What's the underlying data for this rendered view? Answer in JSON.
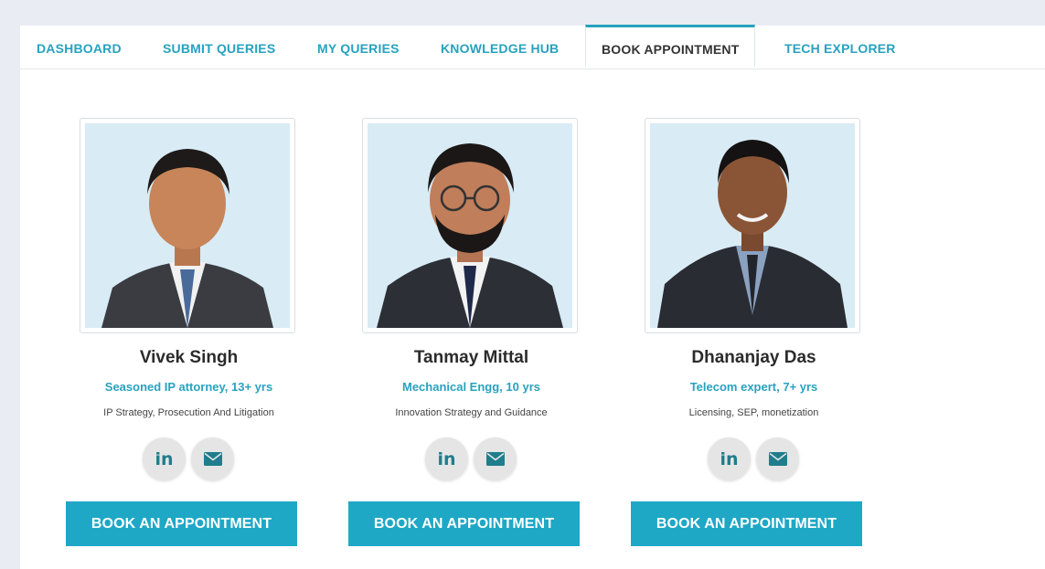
{
  "tabs": [
    {
      "label": "DASHBOARD",
      "active": false
    },
    {
      "label": "SUBMIT QUERIES",
      "active": false
    },
    {
      "label": "MY QUERIES",
      "active": false
    },
    {
      "label": "KNOWLEDGE HUB",
      "active": false
    },
    {
      "label": "BOOK APPOINTMENT",
      "active": true
    },
    {
      "label": "TECH EXPLORER",
      "active": false
    }
  ],
  "experts": [
    {
      "name": "Vivek Singh",
      "role": "Seasoned IP attorney, 13+ yrs",
      "specialty": "IP Strategy, Prosecution And Litigation",
      "linkedin_label": "in",
      "book_label": "BOOK AN APPOINTMENT"
    },
    {
      "name": "Tanmay Mittal",
      "role": "Mechanical Engg, 10 yrs",
      "specialty": "Innovation Strategy and Guidance",
      "linkedin_label": "in",
      "book_label": "BOOK AN APPOINTMENT"
    },
    {
      "name": "Dhananjay Das",
      "role": "Telecom expert, 7+ yrs",
      "specialty": "Licensing, SEP, monetization",
      "linkedin_label": "in",
      "book_label": "BOOK AN APPOINTMENT"
    }
  ],
  "colors": {
    "accent": "#27a2bf",
    "button": "#1ea8c6",
    "photo_bg": "#d9ebf4",
    "icon": "#1f7d8c"
  },
  "icons": {
    "linkedin": "linkedin-icon",
    "email": "envelope-icon"
  }
}
